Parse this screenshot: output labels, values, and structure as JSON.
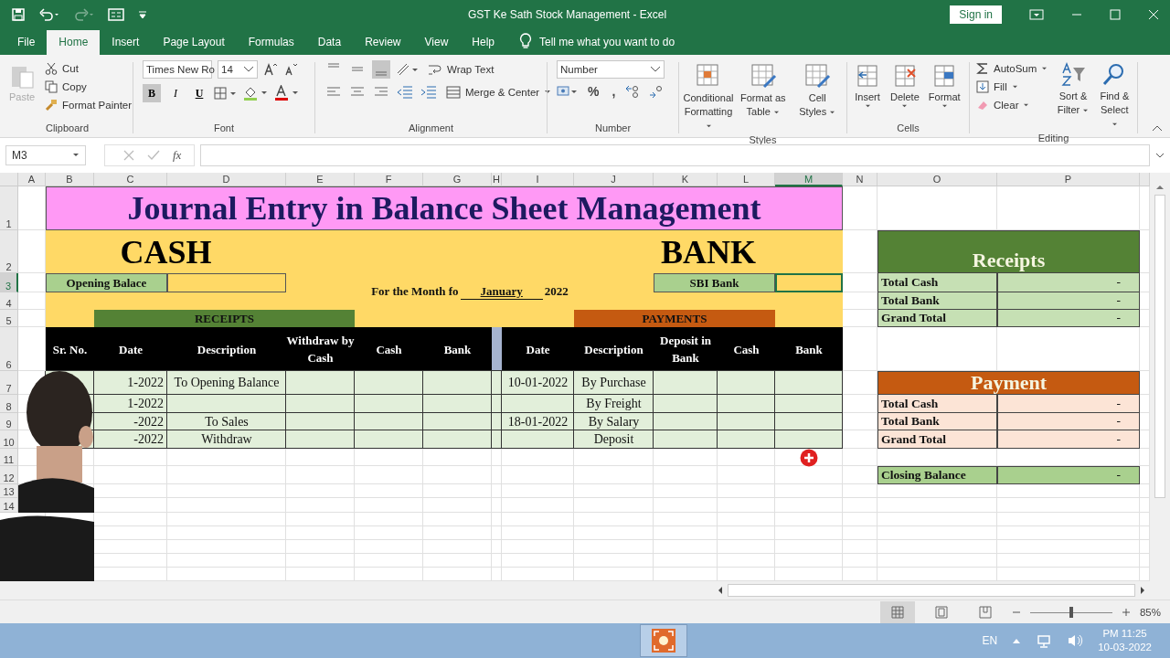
{
  "window": {
    "title": "GST Ke Sath Stock Management  -  Excel",
    "sign_in": "Sign in"
  },
  "tabs": [
    {
      "label": "File",
      "selected": false
    },
    {
      "label": "Home",
      "selected": true
    },
    {
      "label": "Insert",
      "selected": false
    },
    {
      "label": "Page Layout",
      "selected": false
    },
    {
      "label": "Formulas",
      "selected": false
    },
    {
      "label": "Data",
      "selected": false
    },
    {
      "label": "Review",
      "selected": false
    },
    {
      "label": "View",
      "selected": false
    },
    {
      "label": "Help",
      "selected": false
    }
  ],
  "tell_me": "Tell me what you want to do",
  "ribbon": {
    "clipboard": {
      "label": "Clipboard",
      "paste": {
        "label": "Paste",
        "disabled": true
      },
      "tools": [
        "Cut",
        "Copy",
        "Format Painter"
      ]
    },
    "font": {
      "label": "Font",
      "font_name": "Times New Ro",
      "font_size": "14",
      "styles": [
        {
          "label": "B",
          "selected": true
        },
        {
          "label": "I",
          "selected": false
        },
        {
          "label": "U",
          "selected": false
        }
      ]
    },
    "alignment": {
      "label": "Alignment",
      "vertical": [
        {
          "selected": false
        },
        {
          "selected": false
        },
        {
          "selected": true
        }
      ],
      "wrap_text": "Wrap Text",
      "merge": "Merge & Center"
    },
    "number": {
      "label": "Number",
      "format": "Number",
      "percent": "%",
      "comma": ","
    },
    "styles": {
      "label": "Styles",
      "items": [
        "Conditional Formatting",
        "Format as Table",
        "Cell Styles"
      ]
    },
    "cells": {
      "label": "Cells",
      "items": [
        "Insert",
        "Delete",
        "Format"
      ]
    },
    "editing": {
      "label": "Editing",
      "small": [
        "AutoSum",
        "Fill",
        "Clear"
      ],
      "large": [
        "Sort & Filter",
        "Find & Select"
      ]
    }
  },
  "formula_bar": {
    "name_box": "M3",
    "fx": "fx"
  },
  "sheet": {
    "columns": [
      {
        "label": "A",
        "selected": false
      },
      {
        "label": "B",
        "selected": false
      },
      {
        "label": "C",
        "selected": false
      },
      {
        "label": "D",
        "selected": false
      },
      {
        "label": "E",
        "selected": false
      },
      {
        "label": "F",
        "selected": false
      },
      {
        "label": "G",
        "selected": false
      },
      {
        "label": "H",
        "selected": false
      },
      {
        "label": "I",
        "selected": false
      },
      {
        "label": "J",
        "selected": false
      },
      {
        "label": "K",
        "selected": false
      },
      {
        "label": "L",
        "selected": false
      },
      {
        "label": "M",
        "selected": true
      },
      {
        "label": "N",
        "selected": false
      },
      {
        "label": "O",
        "selected": false
      },
      {
        "label": "P",
        "selected": false
      }
    ],
    "rows": [
      {
        "label": "1",
        "selected": false
      },
      {
        "label": "2",
        "selected": false
      },
      {
        "label": "3",
        "selected": true
      },
      {
        "label": "4",
        "selected": false
      },
      {
        "label": "5",
        "selected": false
      },
      {
        "label": "6",
        "selected": false
      },
      {
        "label": "7",
        "selected": false
      },
      {
        "label": "8",
        "selected": false
      },
      {
        "label": "9",
        "selected": false
      },
      {
        "label": "10",
        "selected": false
      },
      {
        "label": "11",
        "selected": false
      },
      {
        "label": "12",
        "selected": false
      },
      {
        "label": "13",
        "selected": false
      },
      {
        "label": "14",
        "selected": false
      }
    ],
    "title": "Journal Entry in Balance Sheet Management",
    "cash_heading": "CASH",
    "bank_heading": "BANK",
    "opening_balance": {
      "label": "Opening Balace"
    },
    "month_line": {
      "prefix": "For the Month fo",
      "month": "January",
      "year": "2022"
    },
    "bank_account": {
      "label": "SBI Bank",
      "field_selected": true
    },
    "receipts_band": "RECEIPTS",
    "payments_band": "PAYMENTS",
    "receipt_columns": [
      "Sr. No.",
      "Date",
      "Description",
      "Withdraw by Cash",
      "Cash",
      "Bank"
    ],
    "payment_columns": [
      "Date",
      "Description",
      "Deposit in Bank",
      "Cash",
      "Bank"
    ],
    "receipts": [
      {
        "date": "1-2022",
        "description": "To Opening Balance"
      },
      {
        "date": "1-2022"
      },
      {
        "date": "-2022",
        "description": "To Sales"
      },
      {
        "date": "-2022",
        "description": "Withdraw"
      }
    ],
    "payments": [
      {
        "date": "10-01-2022",
        "description": "By Purchase"
      },
      {
        "description": "By Freight"
      },
      {
        "date": "18-01-2022",
        "description": "By Salary"
      },
      {
        "description": "Deposit"
      }
    ],
    "receipts_summary": {
      "heading": "Receipts",
      "rows": [
        {
          "label": "Total Cash",
          "value": "-"
        },
        {
          "label": "Total Bank",
          "value": "-"
        },
        {
          "label": "Grand Total",
          "value": "-"
        }
      ]
    },
    "payment_summary": {
      "heading": "Payment",
      "rows": [
        {
          "label": "Total Cash",
          "value": "-"
        },
        {
          "label": "Total Bank",
          "value": "-"
        },
        {
          "label": "Grand Total",
          "value": "-"
        }
      ]
    },
    "closing": {
      "label": "Closing Balance",
      "value": "-"
    }
  },
  "status_bar": {
    "views": [
      {
        "selected": true
      },
      {
        "selected": false
      },
      {
        "selected": false
      }
    ],
    "zoom_slider": {
      "level": 0.5
    },
    "zoom": "85%"
  },
  "taskbar": {
    "language": "EN",
    "time": "PM 11:25",
    "date": "10-03-2022"
  }
}
